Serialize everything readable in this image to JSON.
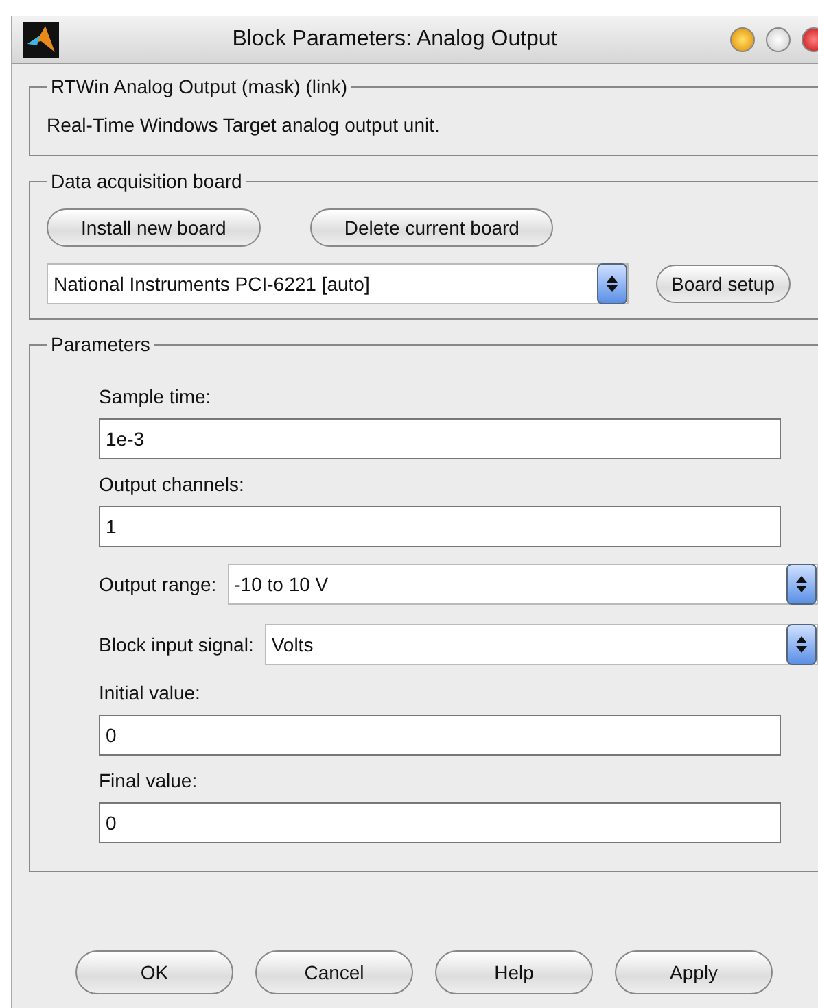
{
  "window": {
    "title": "Block Parameters: Analog Output"
  },
  "description_group": {
    "legend": "RTWin Analog Output (mask) (link)",
    "text": "Real-Time Windows Target analog output unit."
  },
  "board_group": {
    "legend": "Data acquisition board",
    "buttons": [
      "Install new board",
      "Delete current board"
    ],
    "board_select": "National Instruments PCI-6221 [auto]",
    "setup_button": "Board setup"
  },
  "parameters": {
    "legend": "Parameters",
    "items": [
      {
        "kind": "text",
        "label": "Sample time:",
        "value": "1e-3"
      },
      {
        "kind": "text",
        "label": "Output channels:",
        "value": "1"
      },
      {
        "kind": "select",
        "label": "Output range:",
        "value": "-10 to 10 V"
      },
      {
        "kind": "select",
        "label": "Block input signal:",
        "value": "Volts"
      },
      {
        "kind": "text",
        "label": "Initial value:",
        "value": "0"
      },
      {
        "kind": "text",
        "label": "Final value:",
        "value": "0"
      }
    ]
  },
  "buttons": [
    "OK",
    "Cancel",
    "Help",
    "Apply"
  ]
}
